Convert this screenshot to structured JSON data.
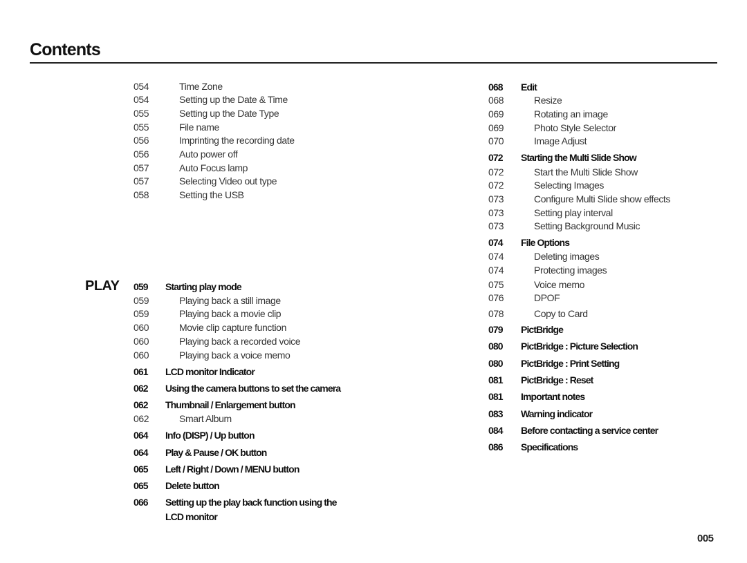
{
  "header": {
    "title": "Contents"
  },
  "section_label": "PLAY",
  "page_number": "005",
  "left_top": [
    {
      "page": "054",
      "text": "Time Zone",
      "bold": false
    },
    {
      "page": "054",
      "text": "Setting up the Date & Time",
      "bold": false
    },
    {
      "page": "055",
      "text": "Setting up the Date Type",
      "bold": false
    },
    {
      "page": "055",
      "text": "File name",
      "bold": false
    },
    {
      "page": "056",
      "text": "Imprinting the recording date",
      "bold": false
    },
    {
      "page": "056",
      "text": "Auto power off",
      "bold": false
    },
    {
      "page": "057",
      "text": "Auto Focus lamp",
      "bold": false
    },
    {
      "page": "057",
      "text": "Selecting Video out type",
      "bold": false
    },
    {
      "page": "058",
      "text": "Setting the USB",
      "bold": false
    }
  ],
  "left_play": [
    {
      "page": "059",
      "text": "Starting play mode",
      "bold": true
    },
    {
      "page": "059",
      "text": "Playing back a still image",
      "bold": false
    },
    {
      "page": "059",
      "text": "Playing back a movie clip",
      "bold": false
    },
    {
      "page": "060",
      "text": "Movie clip capture function",
      "bold": false
    },
    {
      "page": "060",
      "text": "Playing back a recorded voice",
      "bold": false
    },
    {
      "page": "060",
      "text": "Playing back a voice memo",
      "bold": false
    },
    {
      "page": "061",
      "text": "LCD monitor Indicator",
      "bold": true
    },
    {
      "page": "062",
      "text": "Using the camera buttons to set the camera",
      "bold": true
    },
    {
      "page": "062",
      "text": "Thumbnail / Enlargement button",
      "bold": true
    },
    {
      "page": "062",
      "text": "Smart Album",
      "bold": false
    },
    {
      "page": "064",
      "text": "Info (DISP) / Up button",
      "bold": true
    },
    {
      "page": "064",
      "text": "Play & Pause / OK button",
      "bold": true
    },
    {
      "page": "065",
      "text": "Left / Right / Down / MENU button",
      "bold": true
    },
    {
      "page": "065",
      "text": "Delete button",
      "bold": true
    },
    {
      "page": "066",
      "text": "Setting up the play back function using the",
      "bold": true
    },
    {
      "page": "",
      "text": "LCD monitor",
      "bold": true
    }
  ],
  "right": [
    {
      "page": "068",
      "text": "Edit",
      "bold": true
    },
    {
      "page": "068",
      "text": "Resize",
      "bold": false
    },
    {
      "page": "069",
      "text": "Rotating an image",
      "bold": false
    },
    {
      "page": "069",
      "text": "Photo Style Selector",
      "bold": false
    },
    {
      "page": "070",
      "text": "Image Adjust",
      "bold": false
    },
    {
      "page": "072",
      "text": "Starting the Multi Slide Show",
      "bold": true
    },
    {
      "page": "072",
      "text": "Start the Multi Slide Show",
      "bold": false
    },
    {
      "page": "072",
      "text": "Selecting Images",
      "bold": false
    },
    {
      "page": "073",
      "text": "Configure Multi Slide show effects",
      "bold": false
    },
    {
      "page": "073",
      "text": "Setting play interval",
      "bold": false
    },
    {
      "page": "073",
      "text": "Setting Background Music",
      "bold": false
    },
    {
      "page": "074",
      "text": "File Options",
      "bold": true
    },
    {
      "page": "074",
      "text": "Deleting images",
      "bold": false
    },
    {
      "page": "074",
      "text": "Protecting images",
      "bold": false
    },
    {
      "page": "075",
      "text": "Voice memo",
      "bold": false
    },
    {
      "page": "076",
      "text": "DPOF",
      "bold": false
    },
    {
      "page": "078",
      "text": "Copy to Card",
      "bold": false
    },
    {
      "page": "079",
      "text": "PictBridge",
      "bold": true
    },
    {
      "page": "080",
      "text": "PictBridge : Picture Selection",
      "bold": true
    },
    {
      "page": "080",
      "text": "PictBridge : Print Setting",
      "bold": true
    },
    {
      "page": "081",
      "text": "PictBridge : Reset",
      "bold": true
    },
    {
      "page": "081",
      "text": "Important notes",
      "bold": true
    },
    {
      "page": "083",
      "text": "Warning indicator",
      "bold": true
    },
    {
      "page": "084",
      "text": "Before contacting a service center",
      "bold": true
    },
    {
      "page": "086",
      "text": "Specifications",
      "bold": true
    }
  ]
}
